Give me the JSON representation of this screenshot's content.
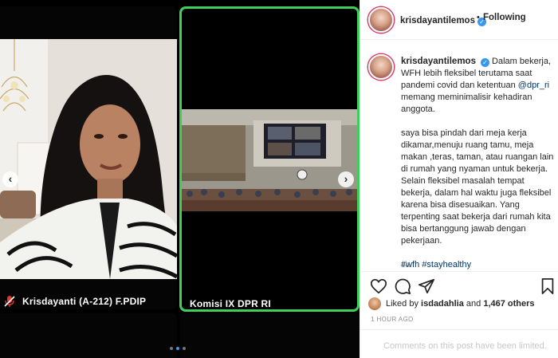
{
  "post": {
    "username": "krisdayantilemos",
    "follow_label": "Following",
    "follow_separator": "•",
    "caption_intro": "Dalam bekerja, WFH lebih fleksibel terutama saat pandemi covid dan ketentuan",
    "caption_mention": "@dpr_ri",
    "caption_intro_end": "memang meminimalisir kehadiran anggota.",
    "caption_body": "saya bisa pindah dari meja kerja dikamar,menuju ruang tamu, meja makan ,teras, taman, atau ruangan lain di rumah yang nyaman untuk bekerja. Selain fleksibel masalah tempat bekerja, dalam hal waktu juga fleksibel karena bisa disesuaikan. Yang terpenting saat bekerja dari rumah kita bisa bertanggung jawab dengan pekerjaan.",
    "hashtag_1": "#wfh",
    "hashtag_2": "#stayhealthy",
    "comment_time": "1h",
    "likes_prefix": "Liked by",
    "likes_user": "isdadahlia",
    "likes_and": "and",
    "likes_count": "1,467 others",
    "post_time": "1 HOUR AGO",
    "comments_limited": "Comments on this post have been limited."
  },
  "media": {
    "left_caption": "Krisdayanti (A-212) F.PDIP",
    "right_caption": "Komisi IX DPR RI",
    "prev_arrow": "‹",
    "next_arrow": "›",
    "highlight_color": "#3fcf5a"
  },
  "icons": {
    "verified": "verified-badge-icon",
    "mic_off": "mic-off-icon",
    "like": "heart-icon",
    "comment": "comment-icon",
    "share": "share-icon",
    "save": "bookmark-icon"
  },
  "carousel": {
    "total": 3,
    "active": 2
  }
}
